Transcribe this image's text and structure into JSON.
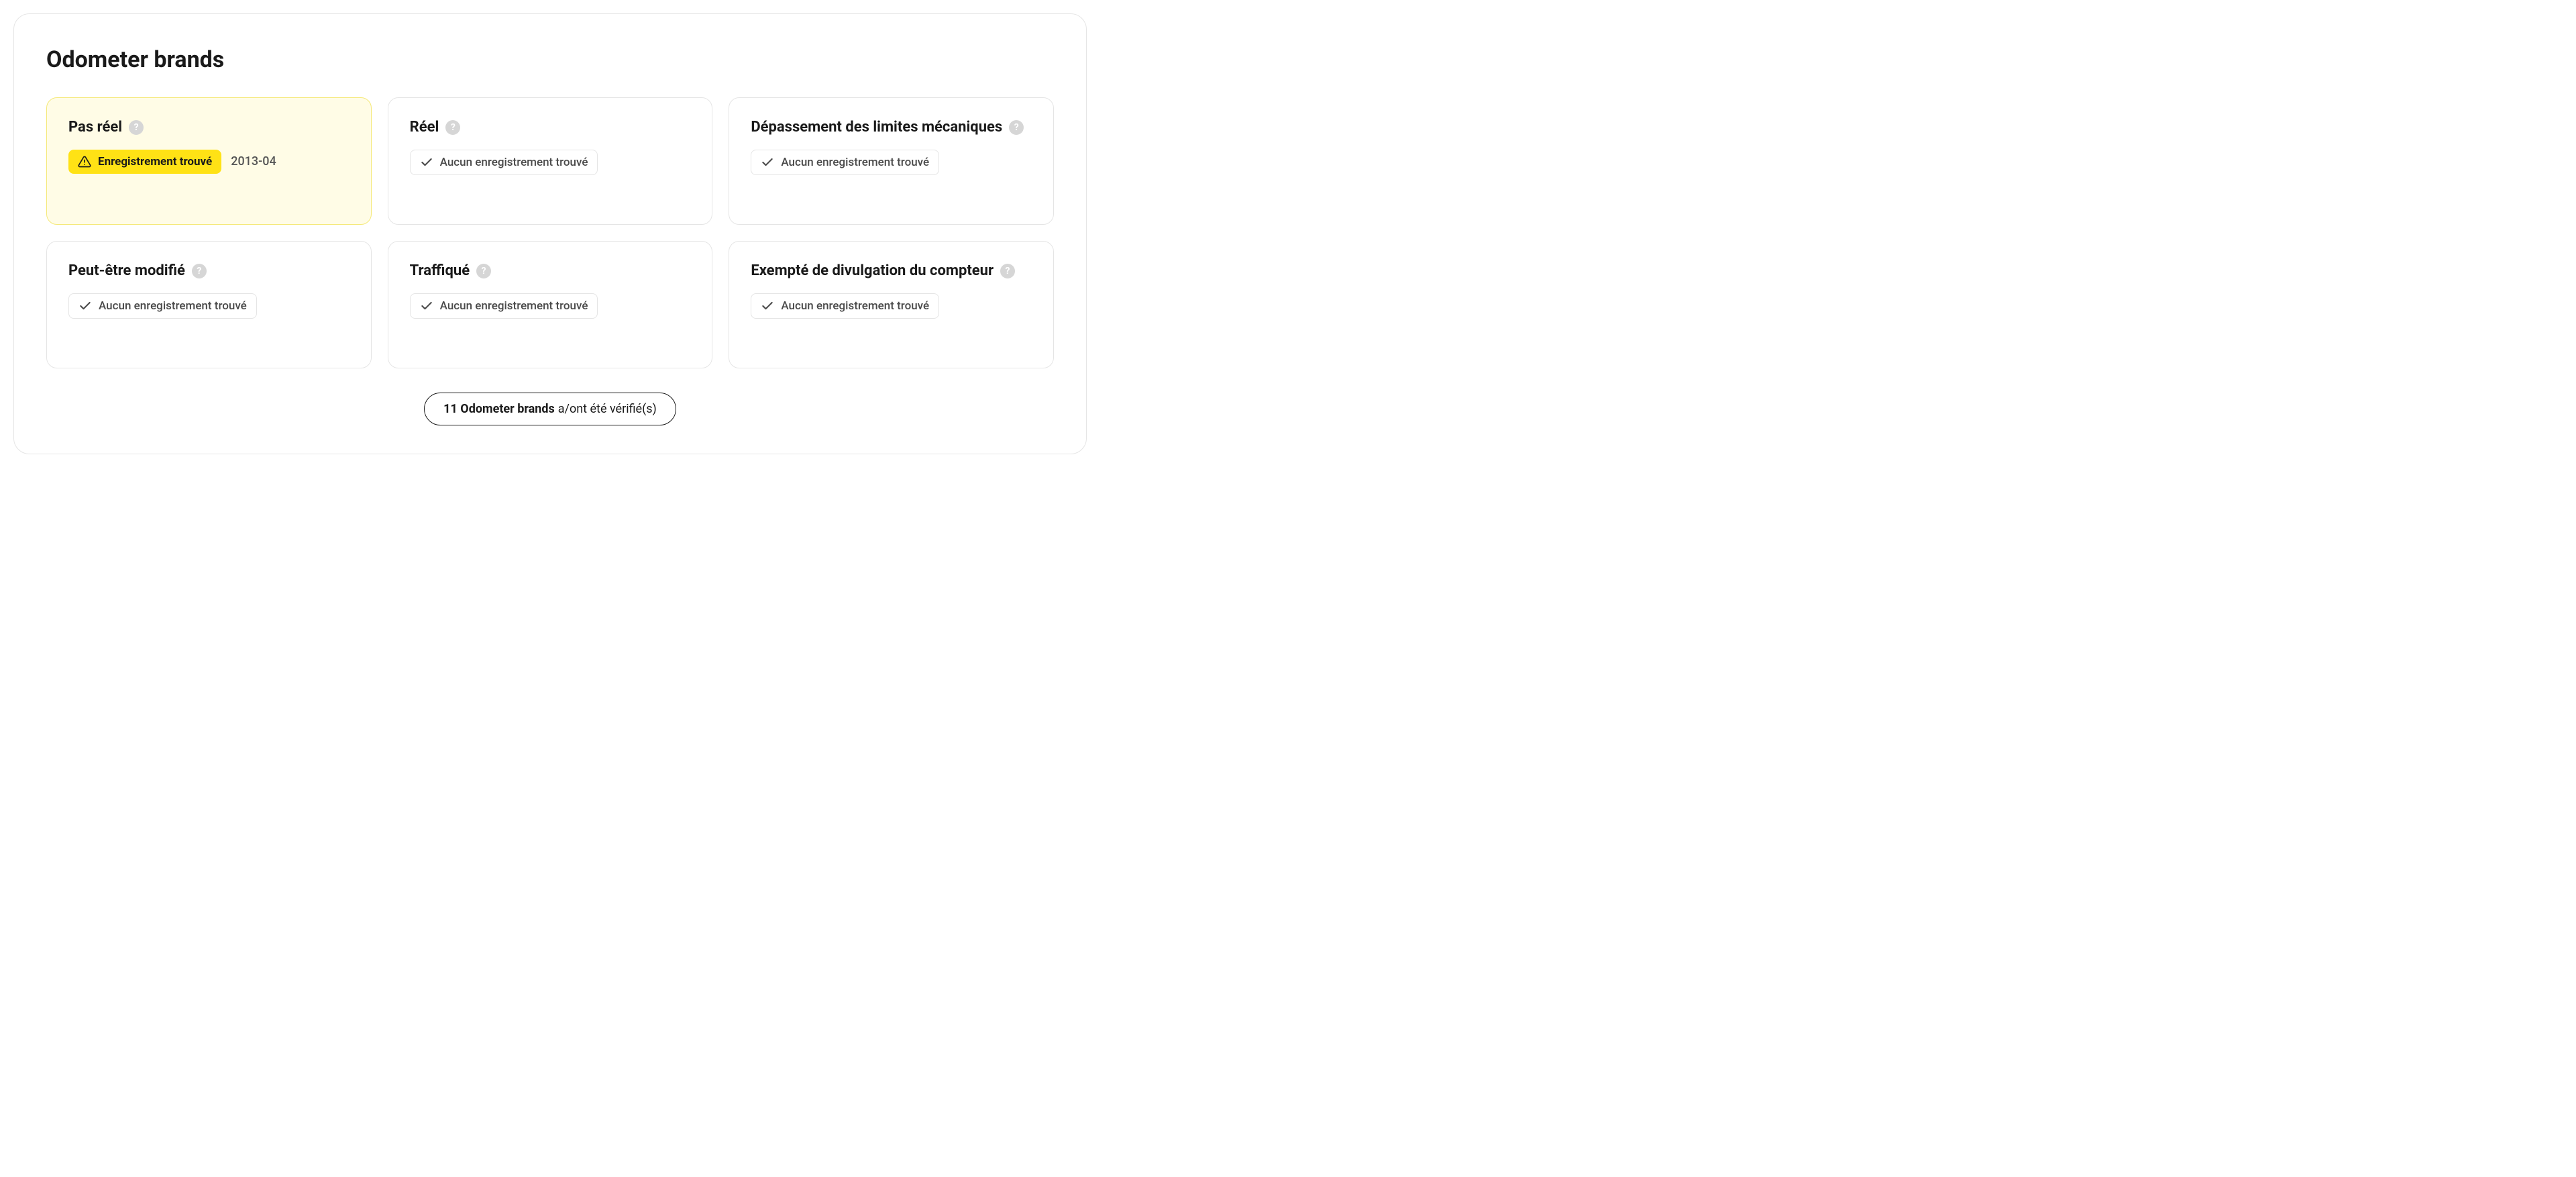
{
  "section": {
    "title": "Odometer brands",
    "cards": [
      {
        "title": "Pas réel",
        "highlighted": true,
        "status": "found",
        "status_text": "Enregistrement trouvé",
        "date": "2013-04"
      },
      {
        "title": "Réel",
        "highlighted": false,
        "status": "none",
        "status_text": "Aucun enregistrement trouvé",
        "date": null
      },
      {
        "title": "Dépassement des limites mécaniques",
        "highlighted": false,
        "status": "none",
        "status_text": "Aucun enregistrement trouvé",
        "date": null
      },
      {
        "title": "Peut-être modifié",
        "highlighted": false,
        "status": "none",
        "status_text": "Aucun enregistrement trouvé",
        "date": null
      },
      {
        "title": "Traffiqué",
        "highlighted": false,
        "status": "none",
        "status_text": "Aucun enregistrement trouvé",
        "date": null
      },
      {
        "title": "Exempté de divulgation du compteur",
        "highlighted": false,
        "status": "none",
        "status_text": "Aucun enregistrement trouvé",
        "date": null
      }
    ],
    "footer": {
      "count_label": "11 Odometer brands",
      "suffix": " a/ont été vérifié(s)"
    }
  }
}
